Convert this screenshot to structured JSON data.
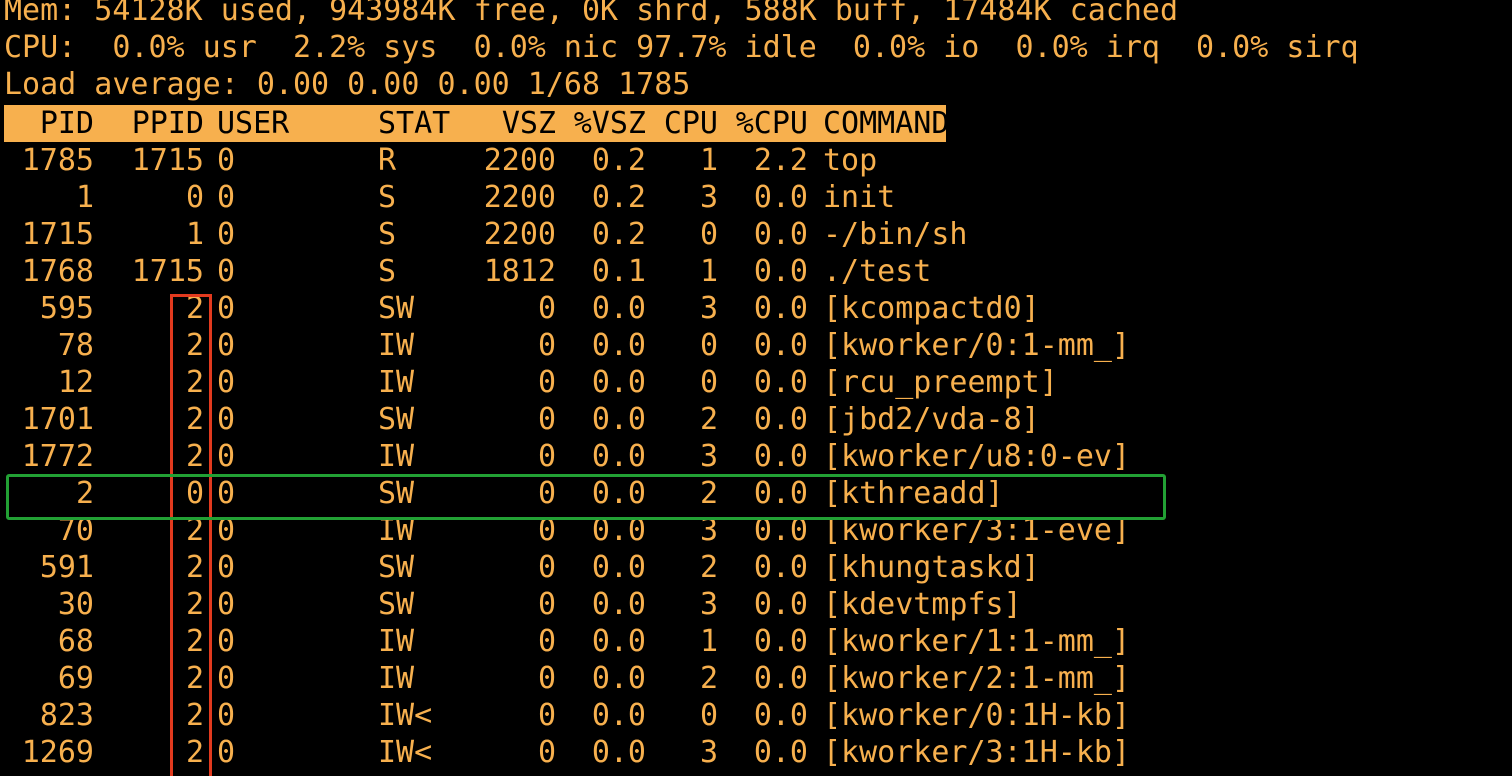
{
  "summary": {
    "mem": "Mem: 54128K used, 943984K free, 0K shrd, 588K buff, 17484K cached",
    "cpu": "CPU:  0.0% usr  2.2% sys  0.0% nic 97.7% idle  0.0% io  0.0% irq  0.0% sirq",
    "load": "Load average: 0.00 0.00 0.00 1/68 1785"
  },
  "table": {
    "headers": {
      "pid": "PID",
      "ppid": "PPID",
      "user": "USER",
      "stat": "STAT",
      "vsz": "VSZ",
      "pvsz": "%VSZ",
      "cpu": "CPU",
      "pcpu": "%CPU",
      "command": "COMMAND"
    },
    "rows": [
      {
        "pid": "1785",
        "ppid": "1715",
        "user": "0",
        "stat": "R",
        "vsz": "2200",
        "pvsz": "0.2",
        "cpu": "1",
        "pcpu": "2.2",
        "command": "top"
      },
      {
        "pid": "1",
        "ppid": "0",
        "user": "0",
        "stat": "S",
        "vsz": "2200",
        "pvsz": "0.2",
        "cpu": "3",
        "pcpu": "0.0",
        "command": "init"
      },
      {
        "pid": "1715",
        "ppid": "1",
        "user": "0",
        "stat": "S",
        "vsz": "2200",
        "pvsz": "0.2",
        "cpu": "0",
        "pcpu": "0.0",
        "command": "-/bin/sh"
      },
      {
        "pid": "1768",
        "ppid": "1715",
        "user": "0",
        "stat": "S",
        "vsz": "1812",
        "pvsz": "0.1",
        "cpu": "1",
        "pcpu": "0.0",
        "command": "./test"
      },
      {
        "pid": "595",
        "ppid": "2",
        "user": "0",
        "stat": "SW",
        "vsz": "0",
        "pvsz": "0.0",
        "cpu": "3",
        "pcpu": "0.0",
        "command": "[kcompactd0]"
      },
      {
        "pid": "78",
        "ppid": "2",
        "user": "0",
        "stat": "IW",
        "vsz": "0",
        "pvsz": "0.0",
        "cpu": "0",
        "pcpu": "0.0",
        "command": "[kworker/0:1-mm_]"
      },
      {
        "pid": "12",
        "ppid": "2",
        "user": "0",
        "stat": "IW",
        "vsz": "0",
        "pvsz": "0.0",
        "cpu": "0",
        "pcpu": "0.0",
        "command": "[rcu_preempt]"
      },
      {
        "pid": "1701",
        "ppid": "2",
        "user": "0",
        "stat": "SW",
        "vsz": "0",
        "pvsz": "0.0",
        "cpu": "2",
        "pcpu": "0.0",
        "command": "[jbd2/vda-8]"
      },
      {
        "pid": "1772",
        "ppid": "2",
        "user": "0",
        "stat": "IW",
        "vsz": "0",
        "pvsz": "0.0",
        "cpu": "3",
        "pcpu": "0.0",
        "command": "[kworker/u8:0-ev]"
      },
      {
        "pid": "2",
        "ppid": "0",
        "user": "0",
        "stat": "SW",
        "vsz": "0",
        "pvsz": "0.0",
        "cpu": "2",
        "pcpu": "0.0",
        "command": "[kthreadd]"
      },
      {
        "pid": "70",
        "ppid": "2",
        "user": "0",
        "stat": "IW",
        "vsz": "0",
        "pvsz": "0.0",
        "cpu": "3",
        "pcpu": "0.0",
        "command": "[kworker/3:1-eve]"
      },
      {
        "pid": "591",
        "ppid": "2",
        "user": "0",
        "stat": "SW",
        "vsz": "0",
        "pvsz": "0.0",
        "cpu": "2",
        "pcpu": "0.0",
        "command": "[khungtaskd]"
      },
      {
        "pid": "30",
        "ppid": "2",
        "user": "0",
        "stat": "SW",
        "vsz": "0",
        "pvsz": "0.0",
        "cpu": "3",
        "pcpu": "0.0",
        "command": "[kdevtmpfs]"
      },
      {
        "pid": "68",
        "ppid": "2",
        "user": "0",
        "stat": "IW",
        "vsz": "0",
        "pvsz": "0.0",
        "cpu": "1",
        "pcpu": "0.0",
        "command": "[kworker/1:1-mm_]"
      },
      {
        "pid": "69",
        "ppid": "2",
        "user": "0",
        "stat": "IW",
        "vsz": "0",
        "pvsz": "0.0",
        "cpu": "2",
        "pcpu": "0.0",
        "command": "[kworker/2:1-mm_]"
      },
      {
        "pid": "823",
        "ppid": "2",
        "user": "0",
        "stat": "IW<",
        "vsz": "0",
        "pvsz": "0.0",
        "cpu": "0",
        "pcpu": "0.0",
        "command": "[kworker/0:1H-kb]"
      },
      {
        "pid": "1269",
        "ppid": "2",
        "user": "0",
        "stat": "IW<",
        "vsz": "0",
        "pvsz": "0.0",
        "cpu": "3",
        "pcpu": "0.0",
        "command": "[kworker/3:1H-kb]"
      }
    ]
  },
  "colors": {
    "text": "#F7B04E",
    "background": "#000000",
    "header_background": "#F7B04E",
    "header_text": "#000000",
    "ppid_highlight": "#E23A1E",
    "row_highlight": "#22A034"
  }
}
